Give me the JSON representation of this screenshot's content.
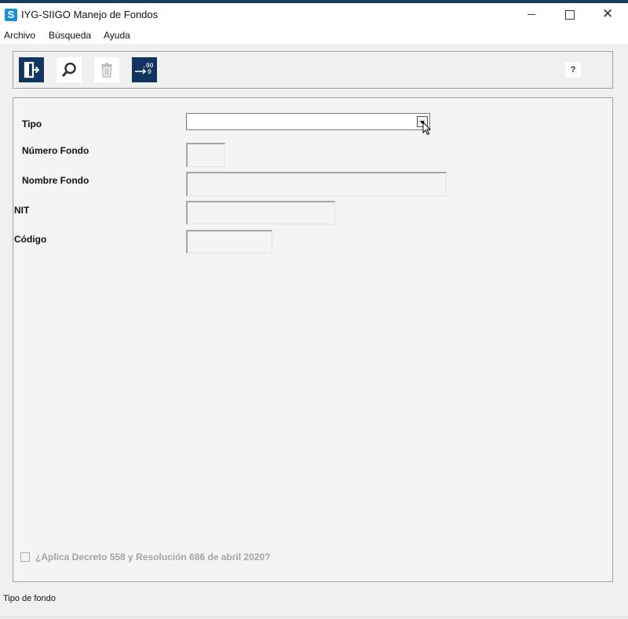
{
  "window": {
    "title": "IYG-SIIGO Manejo de Fondos",
    "app_icon_letter": "S",
    "minimize_icon": "minimize-icon",
    "maximize_icon": "maximize-icon",
    "close_icon": "close-icon",
    "close_glyph": "✕"
  },
  "menu": {
    "items": [
      "Archivo",
      "Búsqueda",
      "Ayuda"
    ]
  },
  "toolbar": {
    "buttons": [
      {
        "icon": "exit-door-icon"
      },
      {
        "icon": "search-icon"
      },
      {
        "icon": "trash-icon"
      },
      {
        "icon": "decimals-icon",
        "text_top": ".00",
        "text_bottom": "0"
      }
    ],
    "help_label": "?",
    "accent_color": "#12355f"
  },
  "form": {
    "tipo": {
      "label": "Tipo",
      "value": ""
    },
    "numero_fondo": {
      "label": "Número Fondo",
      "value": ""
    },
    "nombre_fondo": {
      "label": "Nombre Fondo",
      "value": ""
    },
    "nit": {
      "label": "NIT",
      "value": ""
    },
    "codigo": {
      "label": "Código",
      "value": ""
    },
    "checkbox": {
      "label": "¿Aplica Decreto 558 y Resolución 686 de abril 2020?",
      "checked": false
    }
  },
  "status_bar": {
    "text": "Tipo de fondo"
  }
}
